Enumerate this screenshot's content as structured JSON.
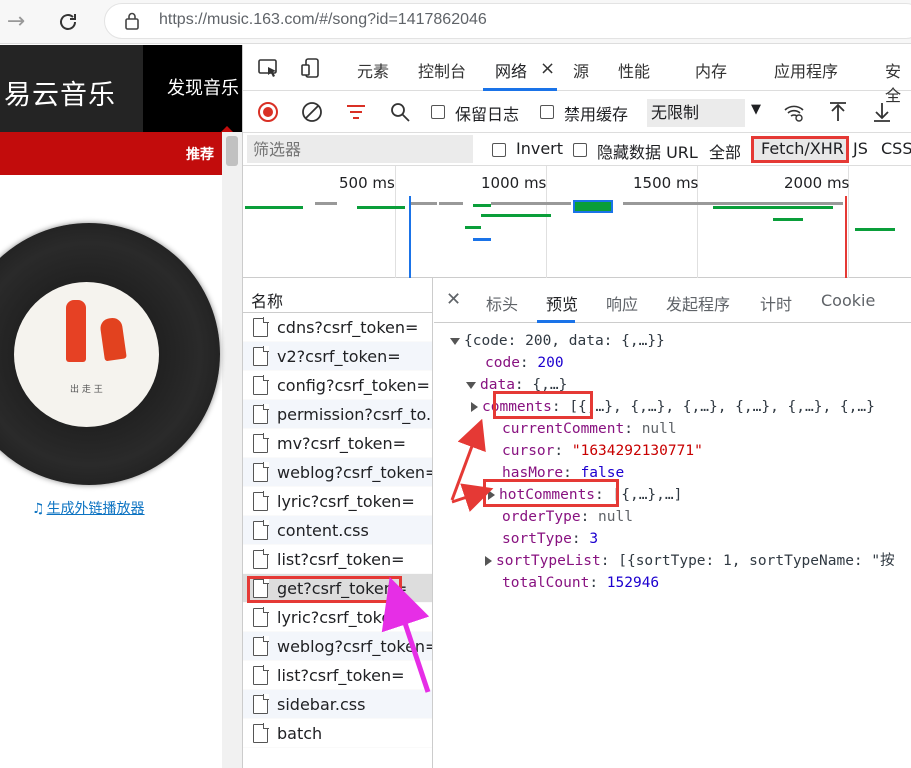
{
  "browser": {
    "url": "https://music.163.com/#/song?id=1417862046",
    "back_icon": "arrow-right-icon",
    "reload_icon": "reload-icon"
  },
  "site": {
    "logo": "易云音乐",
    "nav_active": "发现音乐",
    "sub_tag": "推荐",
    "embed_link": "生成外链播放器",
    "cover_caption": "出 走 王"
  },
  "devtools": {
    "tabs": [
      "元素",
      "控制台",
      "网络",
      "源",
      "性能",
      "内存",
      "应用程序",
      "安全"
    ],
    "active_tab": "网络",
    "toolbar": {
      "preserve_log": "保留日志",
      "disable_cache": "禁用缓存",
      "throttle": "无限制"
    },
    "filter": {
      "placeholder": "筛选器",
      "invert": "Invert",
      "hide_data_url": "隐藏数据 URL",
      "all": "全部",
      "fetch_xhr": "Fetch/XHR",
      "js": "JS",
      "css": "CSS"
    },
    "timeline_ticks": [
      "500 ms",
      "1000 ms",
      "1500 ms",
      "2000 ms"
    ],
    "name_header": "名称",
    "requests": [
      "cdns?csrf_token=",
      "v2?csrf_token=",
      "config?csrf_token=",
      "permission?csrf_to...",
      "mv?csrf_token=",
      "weblog?csrf_token=",
      "lyric?csrf_token=",
      "content.css",
      "list?csrf_token=",
      "get?csrf_token=",
      "lyric?csrf_token=",
      "weblog?csrf_token=",
      "list?csrf_token=",
      "sidebar.css",
      "batch"
    ],
    "selected_request": 9,
    "detail_tabs": [
      "标头",
      "预览",
      "响应",
      "发起程序",
      "计时",
      "Cookie"
    ],
    "active_detail_tab": "预览",
    "preview": {
      "root": "{code: 200, data: {,…}}",
      "code_key": "code",
      "code_val": "200",
      "data_key": "data",
      "data_val": "{,…}",
      "comments_key": "comments",
      "comments_val": "[{,…}, {,…}, {,…}, {,…}, {,…}, {,…}",
      "currentComment_key": "currentComment",
      "currentComment_val": "null",
      "cursor_key": "cursor",
      "cursor_val": "\"1634292130771\"",
      "hasMore_key": "hasMore",
      "hasMore_val": "false",
      "hotComments_key": "hotComments",
      "hotComments_val": "[{,…},…]",
      "orderType_key": "orderType",
      "orderType_val": "null",
      "sortType_key": "sortType",
      "sortType_val": "3",
      "sortTypeList_key": "sortTypeList",
      "sortTypeList_val": "[{sortType: 1, sortTypeName: \"按",
      "totalCount_key": "totalCount",
      "totalCount_val": "152946"
    }
  },
  "colors": {
    "highlight": "#e53935",
    "arrow_magenta": "#e62ee6",
    "brand_red": "#c20c0c",
    "accent_blue": "#1a73e8"
  }
}
